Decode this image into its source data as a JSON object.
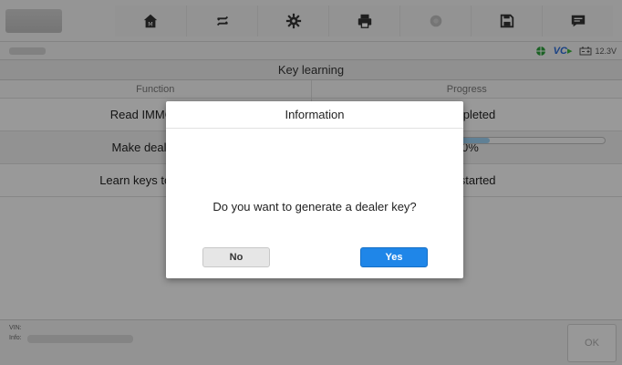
{
  "toolbar": {
    "icons": [
      "home-icon",
      "vehicle-swap-icon",
      "settings-gear-icon",
      "printer-icon",
      "help-icon",
      "save-icon",
      "message-icon"
    ]
  },
  "status": {
    "vci_label": "VC",
    "battery_voltage": "12.3V"
  },
  "screen_title": "Key learning",
  "table": {
    "headers": [
      "Function",
      "Progress"
    ],
    "rows": [
      {
        "function": "Read IMMO data",
        "progress": "Completed"
      },
      {
        "function": "Make dealer key",
        "progress": "30%",
        "progress_fraction": 0.3
      },
      {
        "function": "Learn keys to vehicle",
        "progress": "Not started"
      }
    ]
  },
  "bottom": {
    "vin_label": "VIN:",
    "info_label": "Info:",
    "ok_label": "OK"
  },
  "dialog": {
    "title": "Information",
    "message": "Do you want to generate a dealer key?",
    "no_label": "No",
    "yes_label": "Yes"
  },
  "colors": {
    "accent": "#1f86e8",
    "vci_green": "#3ab23a",
    "overlay": "rgba(0,0,0,0.38)"
  }
}
